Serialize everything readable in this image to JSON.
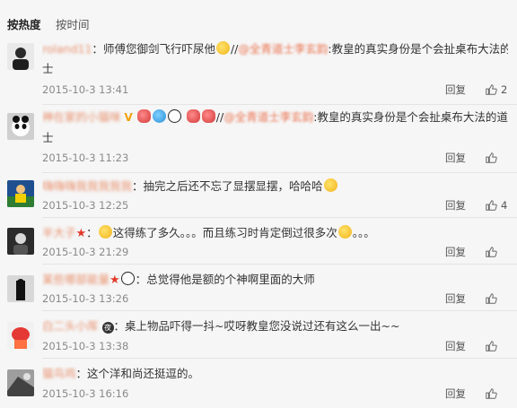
{
  "tabs": [
    "按热度",
    "按时间"
  ],
  "comments": [
    {
      "user": "roland11",
      "mention_sep": "：",
      "text": "师傅您御剑飞行吓尿他",
      "extra": "//",
      "mention": "@全青道士李玄韵",
      "quote": ":教皇的真实身份是个会扯桌布大法的道",
      "line2": "士",
      "time": "2015-10-3 13:41",
      "reply": "回复",
      "likes": "2"
    },
    {
      "user": "神在家的小猫咪",
      "mention_sep": "",
      "text": "",
      "extra": "//",
      "mention": "@全青道士李玄韵",
      "quote": ":教皇的真实身份是个会扯桌布大法的道",
      "line2": "士",
      "time": "2015-10-3 11:23",
      "reply": "回复",
      "likes": ""
    },
    {
      "user": "嗨嗨嗨我我我我我",
      "mention_sep": "：",
      "text": "抽完之后还不忘了显摆显摆，哈哈哈",
      "time": "2015-10-3 12:25",
      "reply": "回复",
      "likes": "4"
    },
    {
      "user": "半大子",
      "mention_sep": "：",
      "text": "这得练了多久。。。而且练习时肯定倒过很多次",
      "tail": "。。。",
      "time": "2015-10-3 21:29",
      "reply": "回复",
      "likes": ""
    },
    {
      "user": "某些哪部能量",
      "mention_sep": "：",
      "text": "总觉得他是额的个神啊里面的大师",
      "time": "2015-10-3 13:26",
      "reply": "回复",
      "likes": ""
    },
    {
      "user": "白二头小厍",
      "mention_sep": "：",
      "badge": "夜",
      "text": "桌上物品吓得一抖~哎呀教皇您没说过还有这么一出~~",
      "time": "2015-10-3 13:38",
      "reply": "回复",
      "likes": ""
    },
    {
      "user": "猫鸟鸡",
      "mention_sep": "：",
      "text": "这个洋和尚还挺逗的。",
      "time": "2015-10-3 16:16",
      "reply": "回复",
      "likes": ""
    }
  ]
}
